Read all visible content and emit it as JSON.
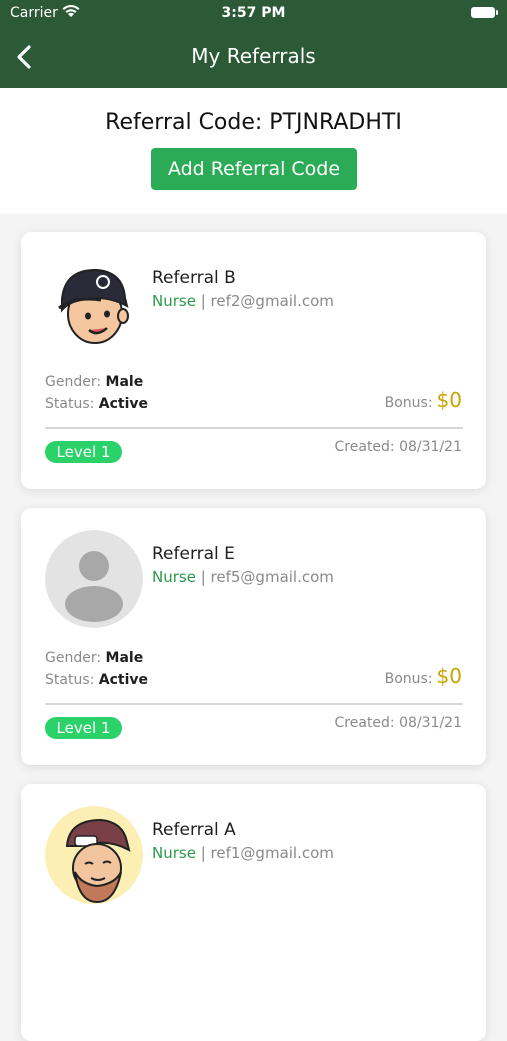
{
  "status_bar": {
    "carrier": "Carrier",
    "time": "3:57 PM"
  },
  "nav": {
    "title": "My Referrals"
  },
  "header": {
    "referral_code": "Referral Code: PTJNRADHTI",
    "add_button": "Add Referral Code"
  },
  "labels": {
    "gender": "Gender:",
    "status": "Status:",
    "bonus": "Bonus:",
    "created": "Created:"
  },
  "referrals": [
    {
      "name": "Referral B",
      "role": "Nurse",
      "sep": " | ",
      "email": "ref2@gmail.com",
      "gender": "Male",
      "status": "Active",
      "bonus": "$0",
      "level": "Level 1",
      "created_date": "08/31/21",
      "avatar": "cartoon-man-cap-icon"
    },
    {
      "name": "Referral E",
      "role": "Nurse",
      "sep": " | ",
      "email": "ref5@gmail.com",
      "gender": "Male",
      "status": "Active",
      "bonus": "$0",
      "level": "Level 1",
      "created_date": "08/31/21",
      "avatar": "default-user-icon"
    },
    {
      "name": "Referral A",
      "role": "Nurse",
      "sep": " | ",
      "email": "ref1@gmail.com",
      "gender": "",
      "status": "",
      "bonus": "",
      "level": "",
      "created_date": "",
      "avatar": "cartoon-bearded-man-icon"
    }
  ],
  "colors": {
    "nav_bg": "#2c5a36",
    "accent_green": "#2bab55",
    "level_green": "#2bd26a",
    "bonus_gold": "#c9a400",
    "role_green": "#2b9a4c"
  }
}
